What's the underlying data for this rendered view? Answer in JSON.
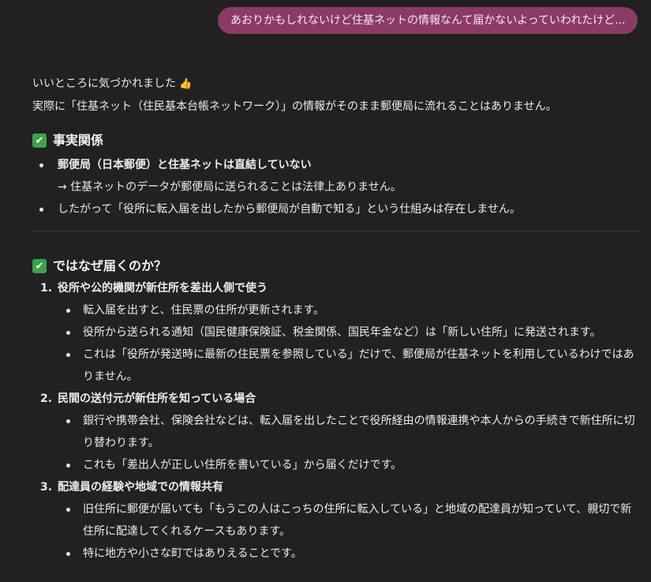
{
  "user_message": "あおりかもしれないけど住基ネットの情報なんて届かないよっていわれたけど...",
  "intro": {
    "line1": "いいところに気づかれました",
    "line1_emoji": "👍",
    "line2": "実際に「住基ネット（住民基本台帳ネットワーク）」の情報がそのまま郵便局に流れることはありません。"
  },
  "section1": {
    "check_icon": "✔",
    "title": "事実関係",
    "items": [
      {
        "bold": "郵便局（日本郵便）と住基ネットは直結していない",
        "text": "→ 住基ネットのデータが郵便局に送られることは法律上ありません。"
      },
      {
        "text": "したがって「役所に転入届を出したから郵便局が自動で知る」という仕組みは存在しません。"
      }
    ]
  },
  "section2": {
    "check_icon": "✔",
    "title": "ではなぜ届くのか？",
    "items": [
      {
        "num": "1.",
        "title": "役所や公的機関が新住所を差出人側で使う",
        "subs": [
          "転入届を出すと、住民票の住所が更新されます。",
          "役所から送られる通知（国民健康保険証、税金関係、国民年金など）は「新しい住所」に発送されます。",
          "これは「役所が発送時に最新の住民票を参照している」だけで、郵便局が住基ネットを利用しているわけではありません。"
        ]
      },
      {
        "num": "2.",
        "title": "民間の送付元が新住所を知っている場合",
        "subs": [
          "銀行や携帯会社、保険会社などは、転入届を出したことで役所経由の情報連携や本人からの手続きで新住所に切り替わります。",
          "これも「差出人が正しい住所を書いている」から届くだけです。"
        ]
      },
      {
        "num": "3.",
        "title": "配達員の経験や地域での情報共有",
        "subs": [
          "旧住所に郵便が届いても「もうこの人はこっちの住所に転入している」と地域の配達員が知っていて、親切で新住所に配達してくれるケースもあります。",
          "特に地方や小さな町ではありえることです。"
        ]
      }
    ]
  }
}
